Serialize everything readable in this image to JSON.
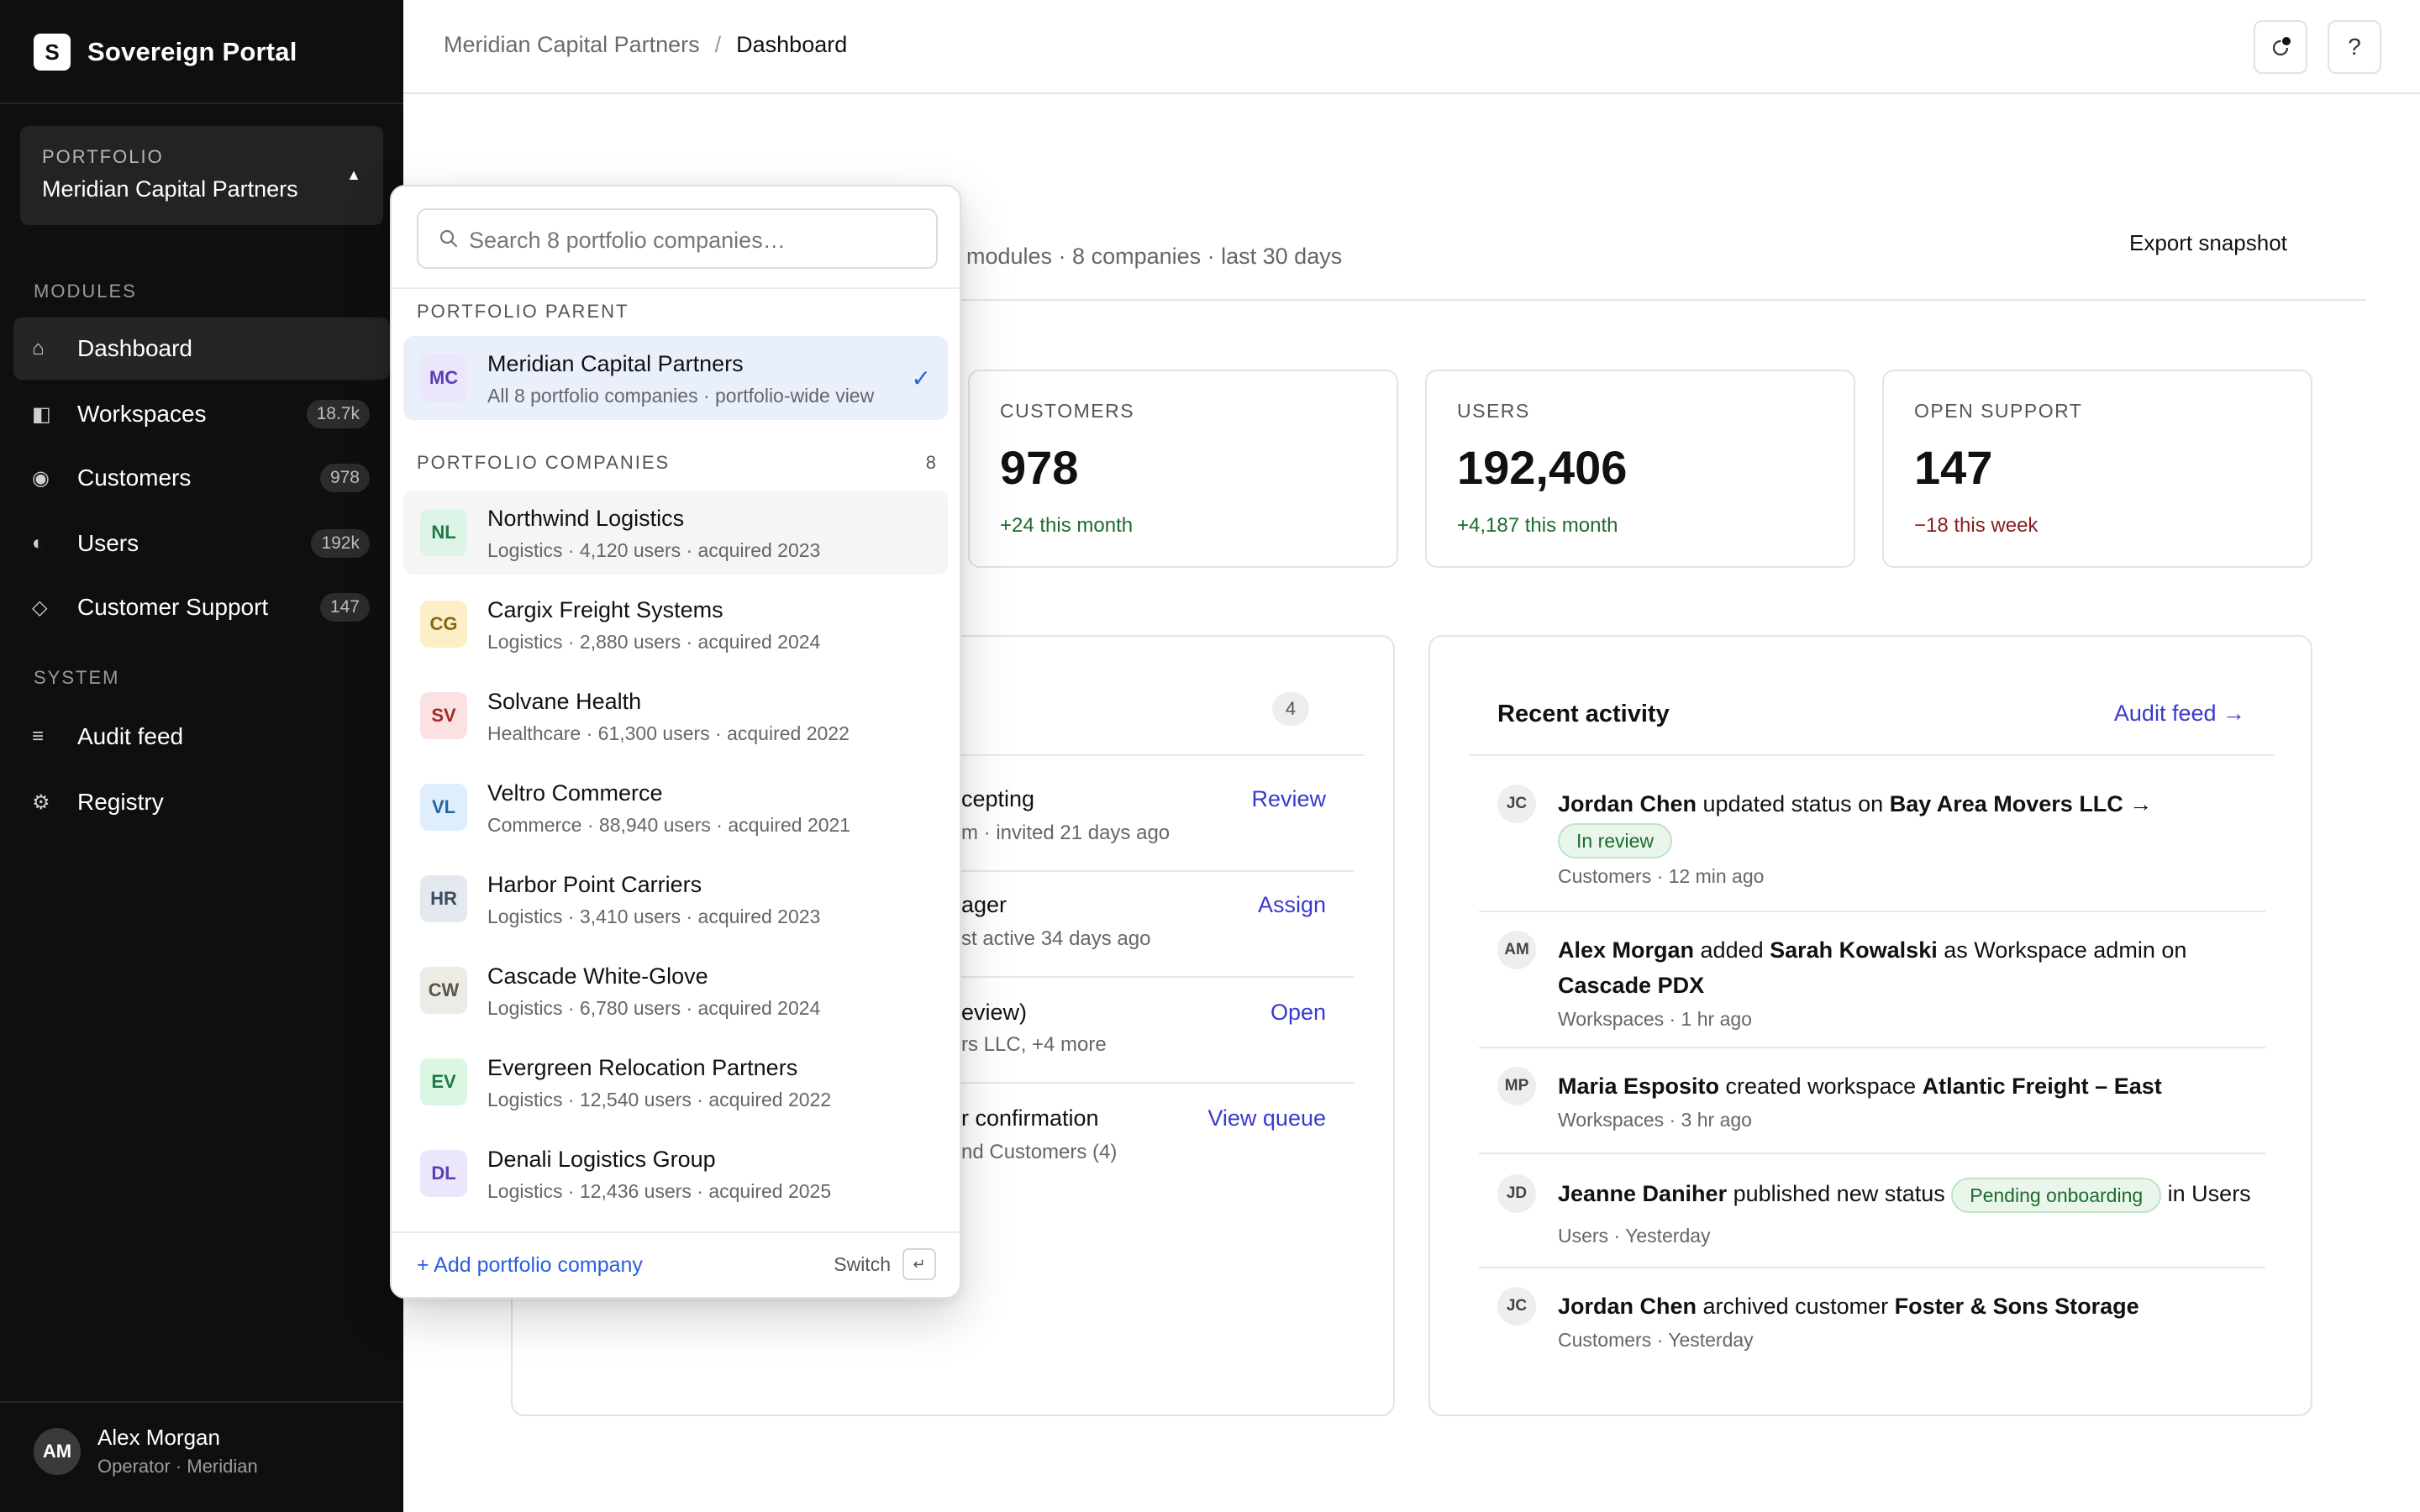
{
  "app": {
    "name": "Sovereign Portal",
    "logo_letter": "S"
  },
  "portfolio_switcher": {
    "caption": "PORTFOLIO",
    "value": "Meridian Capital Partners",
    "caret": "▲"
  },
  "sidebar": {
    "modules_title": "MODULES",
    "modules": [
      {
        "icon": "home-icon",
        "glyph": "⌂",
        "label": "Dashboard",
        "badge": "",
        "active": true
      },
      {
        "icon": "workspaces-icon",
        "glyph": "◧",
        "label": "Workspaces",
        "badge": "18.7k"
      },
      {
        "icon": "customers-icon",
        "glyph": "◉",
        "label": "Customers",
        "badge": "978"
      },
      {
        "icon": "users-icon",
        "glyph": "◐",
        "label": "Users",
        "badge": "192k"
      },
      {
        "icon": "support-icon",
        "glyph": "◇",
        "label": "Customer Support",
        "badge": "147"
      }
    ],
    "system_title": "SYSTEM",
    "system": [
      {
        "icon": "list-icon",
        "glyph": "≡",
        "label": "Audit feed"
      },
      {
        "icon": "gear-icon",
        "glyph": "⚙",
        "label": "Registry"
      }
    ],
    "user": {
      "initials": "AM",
      "name": "Alex Morgan",
      "role": "Operator · Meridian"
    }
  },
  "header": {
    "breadcrumb": [
      "Meridian Capital Partners",
      "Dashboard"
    ],
    "separator": "/",
    "help_label": "?"
  },
  "main": {
    "subtitle_partial": "modules · 8 companies · last 30 days",
    "export_label": "Export snapshot",
    "stats": [
      {
        "caption": "CUSTOMERS",
        "value": "978",
        "delta": "+24 this month",
        "trend": "up"
      },
      {
        "caption": "USERS",
        "value": "192,406",
        "delta": "+4,187 this month",
        "trend": "up"
      },
      {
        "caption": "OPEN SUPPORT",
        "value": "147",
        "delta": "−18 this week",
        "trend": "down"
      }
    ],
    "tasks": {
      "count": "4",
      "items": [
        {
          "line1": "cepting",
          "line2": "m · invited 21 days ago",
          "action": "Review"
        },
        {
          "line1": "ager",
          "line2": "st active 34 days ago",
          "action": "Assign"
        },
        {
          "line1": "eview)",
          "line2": "rs LLC, +4 more",
          "action": "Open"
        },
        {
          "line1": "r confirmation",
          "line2": "nd Customers (4)",
          "action": "View queue"
        }
      ]
    },
    "activity": {
      "title": "Recent activity",
      "link": "Audit feed →",
      "items": [
        {
          "initials": "JC",
          "actor": "Jordan Chen",
          "verb": " updated status on ",
          "object": "Bay Area Movers LLC →",
          "status": "In review",
          "meta": "Customers · 12 min ago"
        },
        {
          "initials": "AM",
          "actor": "Alex Morgan",
          "verb": " added ",
          "object": "Sarah Kowalski",
          "verb2": " as Workspace admin on ",
          "object2": "Cascade PDX",
          "meta": "Workspaces · 1 hr ago"
        },
        {
          "initials": "MP",
          "actor": "Maria Esposito",
          "verb": " created workspace ",
          "object": "Atlantic Freight – East",
          "meta": "Workspaces · 3 hr ago"
        },
        {
          "initials": "JD",
          "actor": "Jeanne Daniher",
          "verb": " published new status ",
          "status": "Pending onboarding",
          "verb2": " in Users",
          "meta": "Users · Yesterday"
        },
        {
          "initials": "JC",
          "actor": "Jordan Chen",
          "verb": " archived customer ",
          "object": "Foster & Sons Storage",
          "meta": "Customers · Yesterday"
        }
      ]
    }
  },
  "dropdown": {
    "search_placeholder": "Search 8 portfolio companies…",
    "parent_title": "PORTFOLIO PARENT",
    "parent": {
      "initials": "MC",
      "name": "Meridian Capital Partners",
      "meta": "All 8 portfolio companies · portfolio-wide view",
      "check": "✓",
      "color_bg": "#ece6fb",
      "color_fg": "#5a3fb3"
    },
    "companies_title": "PORTFOLIO COMPANIES",
    "companies_count": "8",
    "companies": [
      {
        "initials": "NL",
        "name": "Northwind Logistics",
        "meta": "Logistics · 4,120 users · acquired 2023",
        "color_bg": "#dcf5e6",
        "color_fg": "#1f7a45"
      },
      {
        "initials": "CG",
        "name": "Cargix Freight Systems",
        "meta": "Logistics · 2,880 users · acquired 2024",
        "color_bg": "#fcefc8",
        "color_fg": "#8a6512"
      },
      {
        "initials": "SV",
        "name": "Solvane Health",
        "meta": "Healthcare · 61,300 users · acquired 2022",
        "color_bg": "#fbe1e1",
        "color_fg": "#a42a2a"
      },
      {
        "initials": "VL",
        "name": "Veltro Commerce",
        "meta": "Commerce · 88,940 users · acquired 2021",
        "color_bg": "#dfeefc",
        "color_fg": "#2662a8"
      },
      {
        "initials": "HR",
        "name": "Harbor Point Carriers",
        "meta": "Logistics · 3,410 users · acquired 2023",
        "color_bg": "#e4e8ef",
        "color_fg": "#3d4a60"
      },
      {
        "initials": "CW",
        "name": "Cascade White-Glove",
        "meta": "Logistics · 6,780 users · acquired 2024",
        "color_bg": "#ecebe6",
        "color_fg": "#5a574b"
      },
      {
        "initials": "EV",
        "name": "Evergreen Relocation Partners",
        "meta": "Logistics · 12,540 users · acquired 2022",
        "color_bg": "#dcf6e4",
        "color_fg": "#1f7a45"
      },
      {
        "initials": "DL",
        "name": "Denali Logistics Group",
        "meta": "Logistics · 12,436 users · acquired 2025",
        "color_bg": "#ebe6fb",
        "color_fg": "#5a3fb3"
      }
    ],
    "add_label": "+ Add portfolio company",
    "switch_label": "Switch",
    "enter_key": "↵"
  }
}
